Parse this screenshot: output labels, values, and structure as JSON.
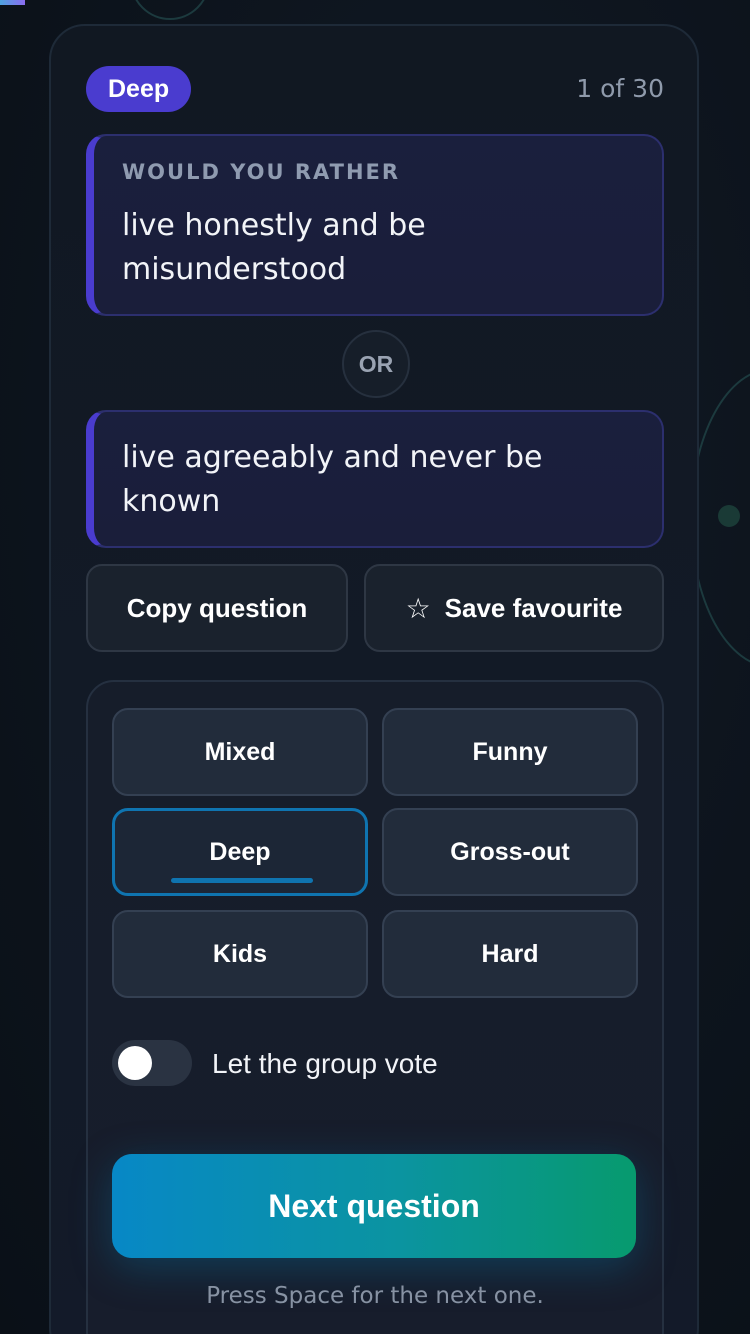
{
  "progress": {
    "fraction": 0.0333,
    "color_start": "#4fa3e0",
    "color_end": "#8b6cf0"
  },
  "header": {
    "category_badge": "Deep",
    "counter": "1 of 30"
  },
  "question": {
    "prompt_label": "WOULD YOU RATHER",
    "option_a": "live honestly and be misunderstood",
    "or_label": "OR",
    "option_b": "live agreeably and never be known"
  },
  "actions": {
    "copy_label": "Copy question",
    "favourite_icon": "star-outline-icon",
    "favourite_label": "Save favourite"
  },
  "categories": {
    "items": [
      {
        "label": "Mixed",
        "active": false
      },
      {
        "label": "Funny",
        "active": false
      },
      {
        "label": "Deep",
        "active": true
      },
      {
        "label": "Gross-out",
        "active": false
      },
      {
        "label": "Kids",
        "active": false
      },
      {
        "label": "Hard",
        "active": false
      }
    ]
  },
  "vote_toggle": {
    "label": "Let the group vote",
    "on": false
  },
  "next_button": {
    "label": "Next question",
    "hint": "Press Space for the next one."
  },
  "colors": {
    "accent": "#4a3ccf",
    "active_category": "#0f74b0",
    "next_gradient_start": "#0788c6",
    "next_gradient_end": "#079a6e"
  }
}
